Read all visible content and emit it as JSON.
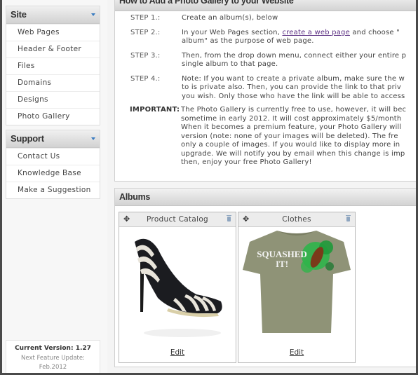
{
  "sidebar": {
    "site": {
      "title": "Site",
      "items": [
        {
          "label": "Web Pages"
        },
        {
          "label": "Header & Footer"
        },
        {
          "label": "Files"
        },
        {
          "label": "Domains"
        },
        {
          "label": "Designs"
        },
        {
          "label": "Photo Gallery"
        }
      ]
    },
    "support": {
      "title": "Support",
      "items": [
        {
          "label": "Contact Us"
        },
        {
          "label": "Knowledge Base"
        },
        {
          "label": "Make a Suggestion"
        }
      ]
    },
    "version": {
      "title": "Current Version: 1.27",
      "next_label": "Next Feature Update:",
      "next_date": "Feb.2012"
    }
  },
  "howto": {
    "title": "How to Add a Photo Gallery to your Website",
    "steps": [
      {
        "label": "STEP 1.:",
        "text": "Create an album(s), below"
      },
      {
        "label": "STEP 2.:",
        "text_before": "In your Web Pages section, ",
        "link": "create a web page",
        "text_after": " and choose \"\nalbum\" as the purpose of web page."
      },
      {
        "label": "STEP 3.:",
        "text": "Then, from the drop down menu, connect either your entire p\nsingle album to that page."
      },
      {
        "label": "STEP 4.:",
        "text": "Note: If you want to create a private album, make sure the w\nto is private also. Then, you can provide the link to that priv\nyou wish. Only those who have the link will be able to access"
      }
    ],
    "important": {
      "label": "IMPORTANT:",
      "text": "The Photo Gallery is currently free to use, however, it will bec\nsometime in early 2012. It will cost approximately $5/month\nWhen it becomes a premium feature, your Photo Gallery will\nversion (note: none of your images will be deleted). The fre\nonly a couple of images. If you would like to display more in\nupgrade. We will notify you by email when this change is imp\nthen, enjoy your free Photo Gallery!"
    }
  },
  "albums": {
    "title": "Albums",
    "items": [
      {
        "name": "Product Catalog",
        "image": "black-and-white-high-heel-shoe",
        "edit_label": "Edit"
      },
      {
        "name": "Clothes",
        "image": "olive-tshirt-squashed-it",
        "edit_label": "Edit",
        "shirt_text": "SQUASHED IT!"
      }
    ]
  },
  "colors": {
    "accent_arrow": "#3a7cc1",
    "link_visited": "#5a2d82",
    "tshirt": "#8f9377",
    "splat": "#2fb54a"
  }
}
